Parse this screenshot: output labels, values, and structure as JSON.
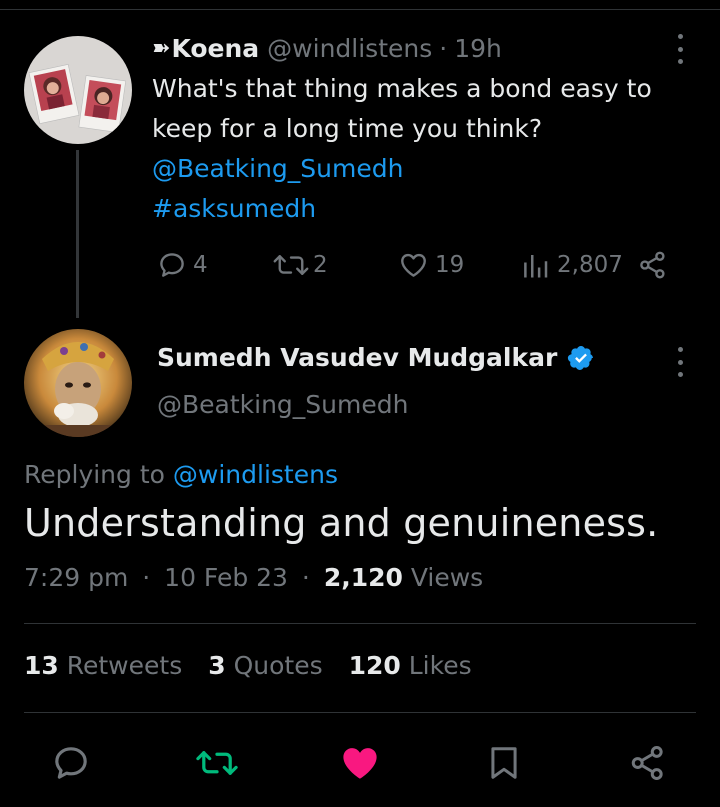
{
  "parent_tweet": {
    "display_name": "Koena",
    "name_prefix_glyph": "➽",
    "handle": "@windlistens",
    "separator": "·",
    "time": "19h",
    "text_lines": [
      "What's that thing makes a bond easy to",
      "keep for a long time you think?"
    ],
    "mention": "@Beatking_Sumedh",
    "hashtag": "#asksumedh",
    "replies": "4",
    "retweets": "2",
    "likes": "19",
    "views": "2,807"
  },
  "main_tweet": {
    "display_name": "Sumedh Vasudev Mudgalkar",
    "verified": true,
    "handle": "@Beatking_Sumedh",
    "replying_prefix": "Replying to",
    "replying_to": "@windlistens",
    "text": "Understanding and genuineness.",
    "time": "7:29 pm",
    "date": "10 Feb 23",
    "views_count": "2,120",
    "views_label": "Views",
    "retweets_count": "13",
    "retweets_label": "Retweets",
    "quotes_count": "3",
    "quotes_label": "Quotes",
    "likes_count": "120",
    "likes_label": "Likes"
  },
  "colors": {
    "background": "#000000",
    "text": "#e7e9ea",
    "secondary": "#71767b",
    "link": "#1d9bf0",
    "retweet_active": "#00ba7c",
    "like_active": "#f91880",
    "divider": "#2f3336"
  },
  "icons": {
    "reply": "reply-icon",
    "retweet": "retweet-icon",
    "like": "heart-icon",
    "views": "analytics-icon",
    "share": "share-icon",
    "bookmark": "bookmark-icon",
    "more": "more-icon",
    "verified": "verified-badge-icon"
  }
}
